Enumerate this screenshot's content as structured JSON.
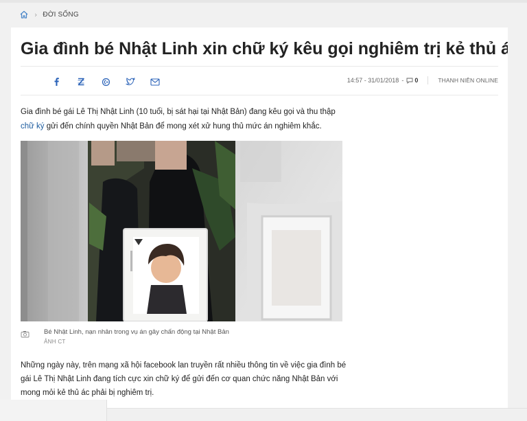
{
  "breadcrumb": {
    "home_icon": "home-icon",
    "category": "ĐỜI SỐNG"
  },
  "article": {
    "title": "Gia đình bé Nhật Linh xin chữ ký kêu gọi nghiêm trị kẻ thủ ác",
    "share_icons": [
      "facebook-icon",
      "zalo-icon",
      "google-plus-icon",
      "twitter-icon",
      "email-icon"
    ],
    "timestamp": "14:57 - 31/01/2018",
    "comment_count": "0",
    "source": "THANH NIÊN ONLINE",
    "lead_part1": "Gia đình bé gái Lê Thị Nhật Linh (10 tuổi, bị sát hại tại Nhật Bản) đang kêu gọi và thu thập ",
    "lead_link": "chữ ký",
    "lead_part2": " gửi đến chính quyền Nhật Bản để mong xét xử hung thủ mức án nghiêm khắc.",
    "photo_caption": "Bé Nhật Linh, nạn nhân trong vụ án gây chấn động tại Nhật Bản",
    "photo_credit": "ẢNH CT",
    "paragraph1": "Những ngày này, trên mạng xã hội facebook lan truyền rất nhiều thông tin về việc gia đình bé gái Lê Thị Nhật Linh đang tích cực xin chữ ký để gửi đến cơ quan chức năng Nhật Bản với mong mỏi kẻ thủ ác phải bị nghiêm trị."
  },
  "colors": {
    "link": "#1a5a9e",
    "share_icon": "#2a62b8",
    "home_icon": "#4a86c8"
  }
}
